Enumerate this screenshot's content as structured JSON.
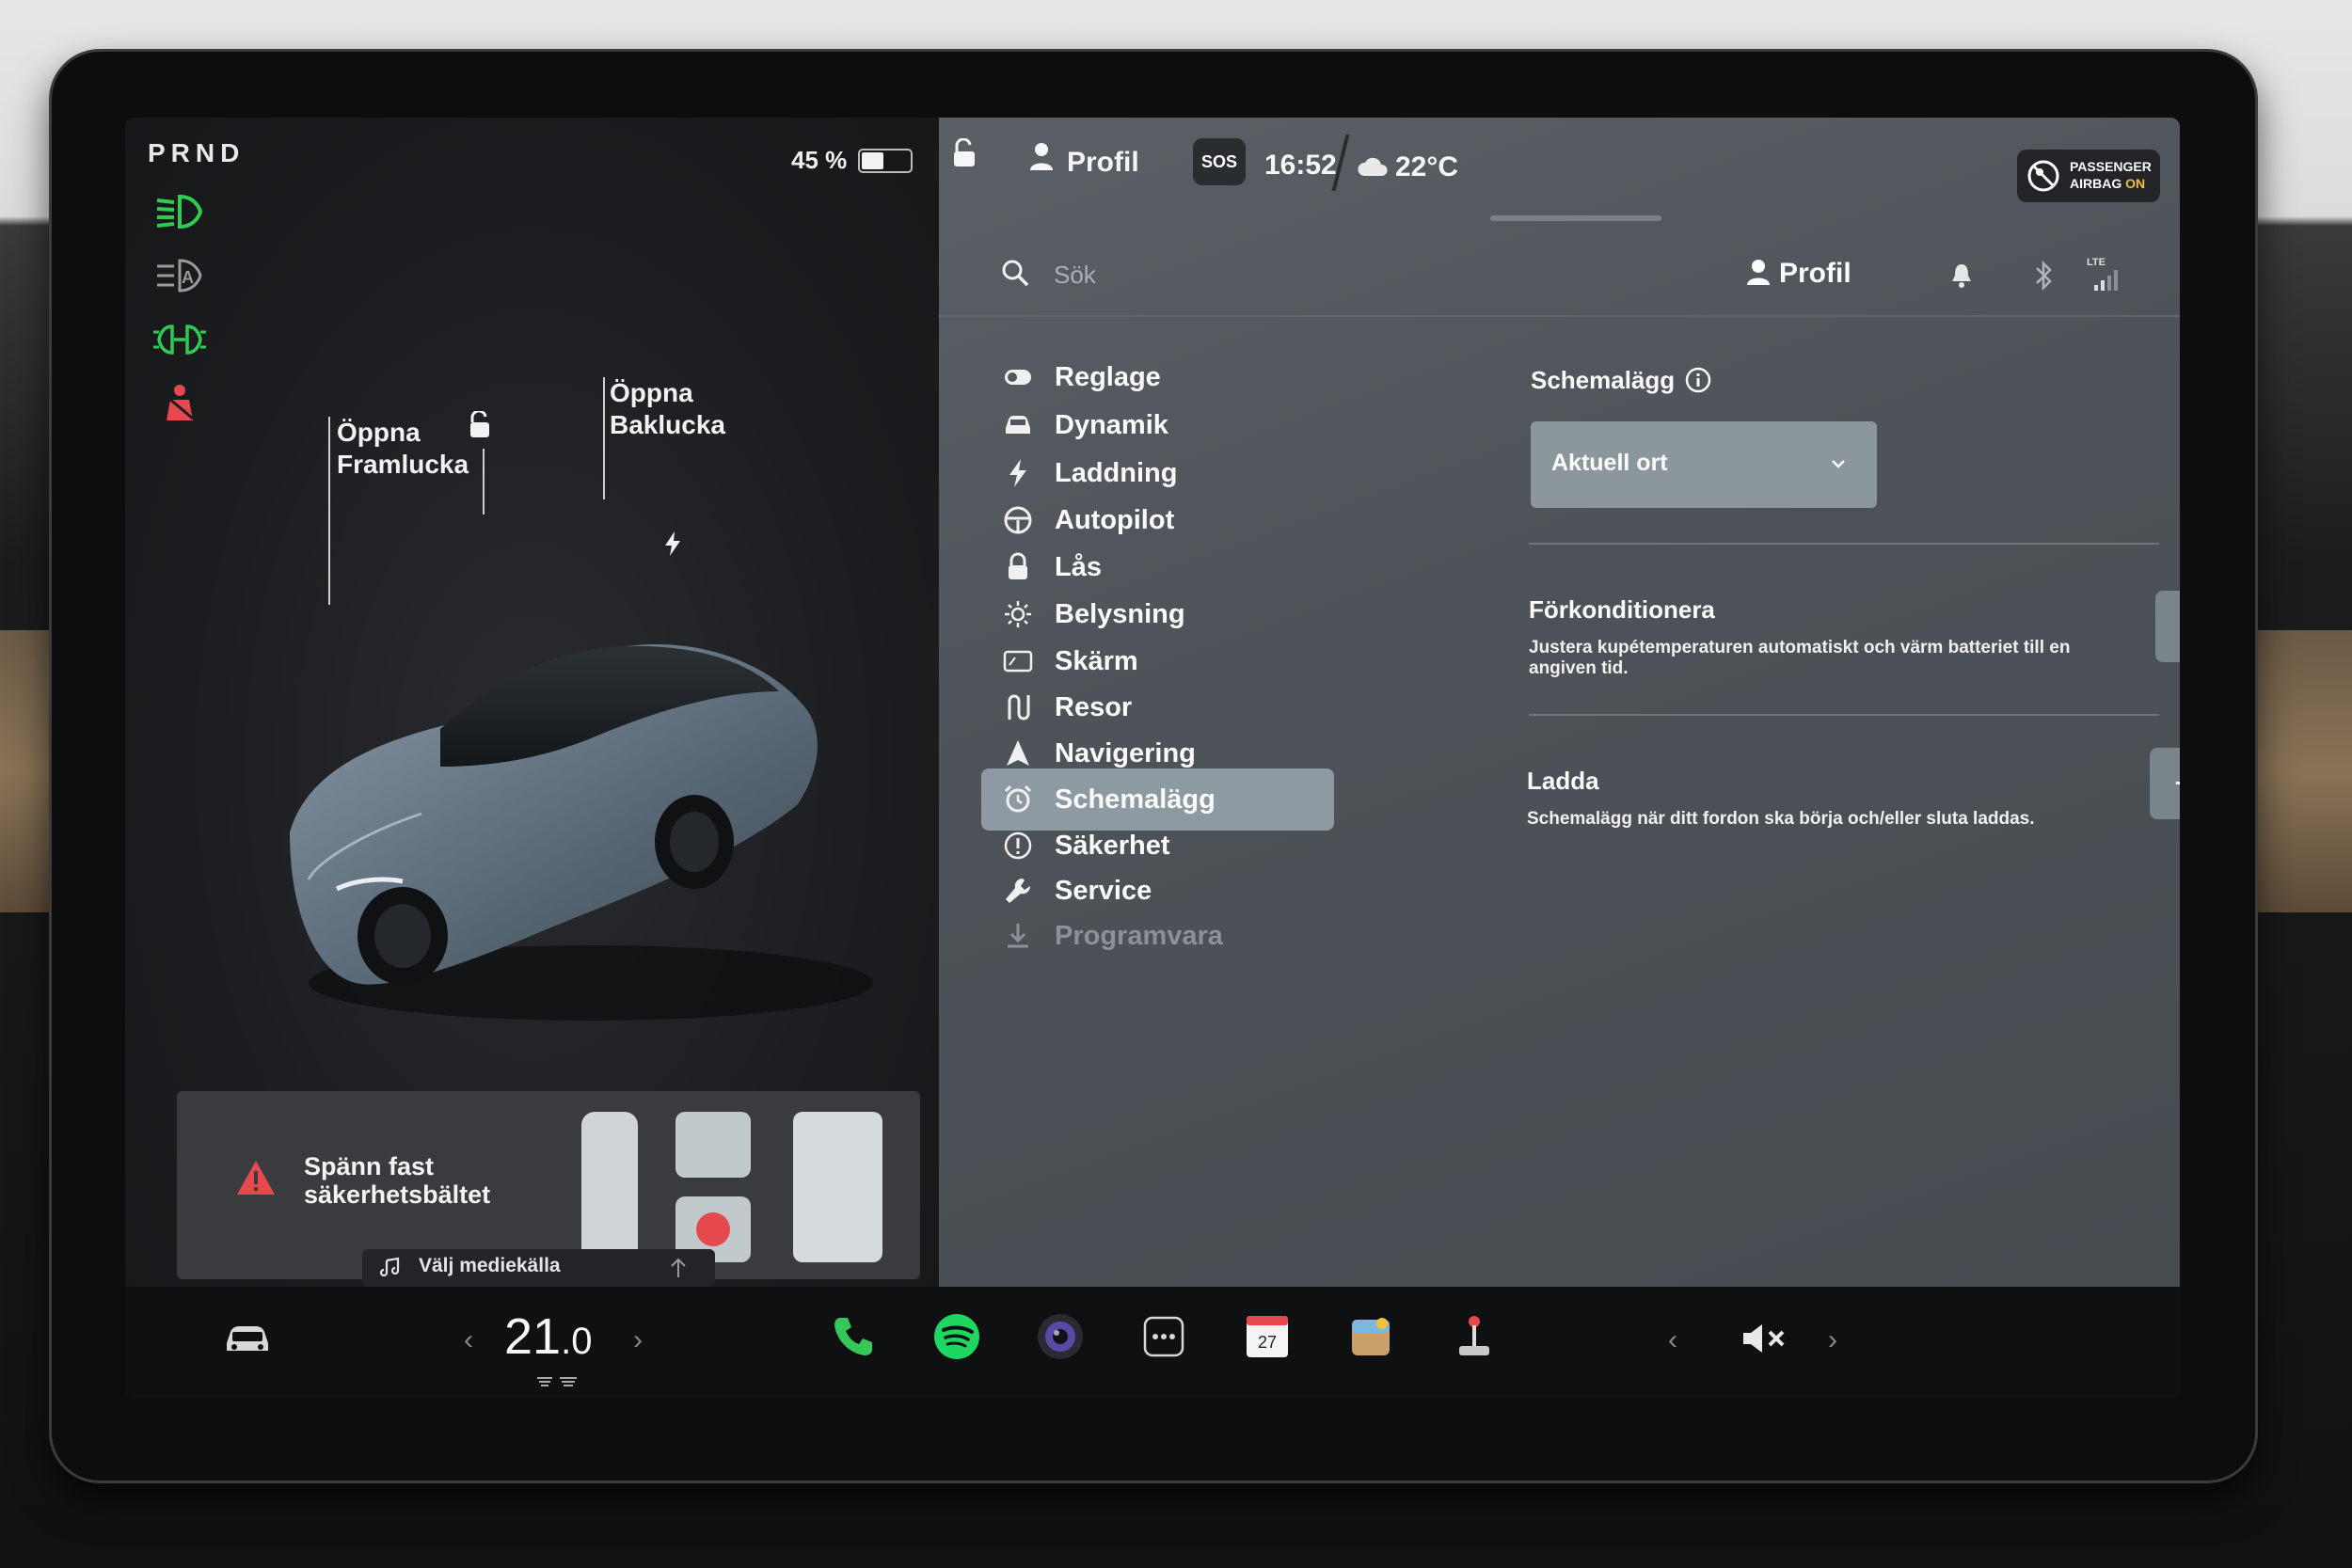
{
  "left": {
    "gear": "PRND",
    "battery": {
      "percent_label": "45 %",
      "level": 0.45
    },
    "callouts": {
      "frunk_line1": "Öppna",
      "frunk_line2": "Framlucka",
      "trunk_line1": "Öppna",
      "trunk_line2": "Baklucka"
    },
    "alert": {
      "line1": "Spänn fast",
      "line2": "säkerhetsbältet"
    },
    "media": {
      "label": "Välj mediekälla"
    }
  },
  "topbar": {
    "profile": "Profil",
    "sos": "SOS",
    "time": "16:52",
    "temperature": "22°C",
    "airbag_line1": "PASSENGER",
    "airbag_line2_prefix": "AIRBAG ",
    "airbag_line2_status": "ON"
  },
  "search": {
    "placeholder": "Sök",
    "profile": "Profil",
    "network": "LTE"
  },
  "menu": {
    "items": [
      {
        "label": "Reglage",
        "icon": "toggle-icon"
      },
      {
        "label": "Dynamik",
        "icon": "car-icon"
      },
      {
        "label": "Laddning",
        "icon": "bolt-icon"
      },
      {
        "label": "Autopilot",
        "icon": "steering-wheel-icon"
      },
      {
        "label": "Lås",
        "icon": "lock-icon"
      },
      {
        "label": "Belysning",
        "icon": "sun-icon"
      },
      {
        "label": "Skärm",
        "icon": "display-icon"
      },
      {
        "label": "Resor",
        "icon": "route-icon"
      },
      {
        "label": "Navigering",
        "icon": "navigation-icon"
      },
      {
        "label": "Schemalägg",
        "icon": "alarm-clock-icon",
        "active": true
      },
      {
        "label": "Säkerhet",
        "icon": "alert-circle-icon"
      },
      {
        "label": "Service",
        "icon": "wrench-icon"
      },
      {
        "label": "Programvara",
        "icon": "download-icon"
      }
    ]
  },
  "schedule": {
    "title": "Schemalägg",
    "location_value": "Aktuell ort",
    "precondition": {
      "title": "Förkonditionera",
      "desc_line1": "Justera kupétemperaturen automatiskt och värm batteriet till en",
      "desc_line2": "angiven tid."
    },
    "charge": {
      "title": "Ladda",
      "desc": "Schemalägg när ditt fordon ska börja och/eller sluta laddas."
    }
  },
  "bottom": {
    "temp_main": "21",
    "temp_decimal": ".0",
    "calendar_day": "27"
  },
  "colors": {
    "indicator_green": "#2ecc52",
    "warning_red": "#e5484d",
    "active_menu": "#8d9aa2",
    "spotify_green": "#1ed760",
    "phone_green": "#35c759",
    "airbag_on": "#f5c23a"
  }
}
